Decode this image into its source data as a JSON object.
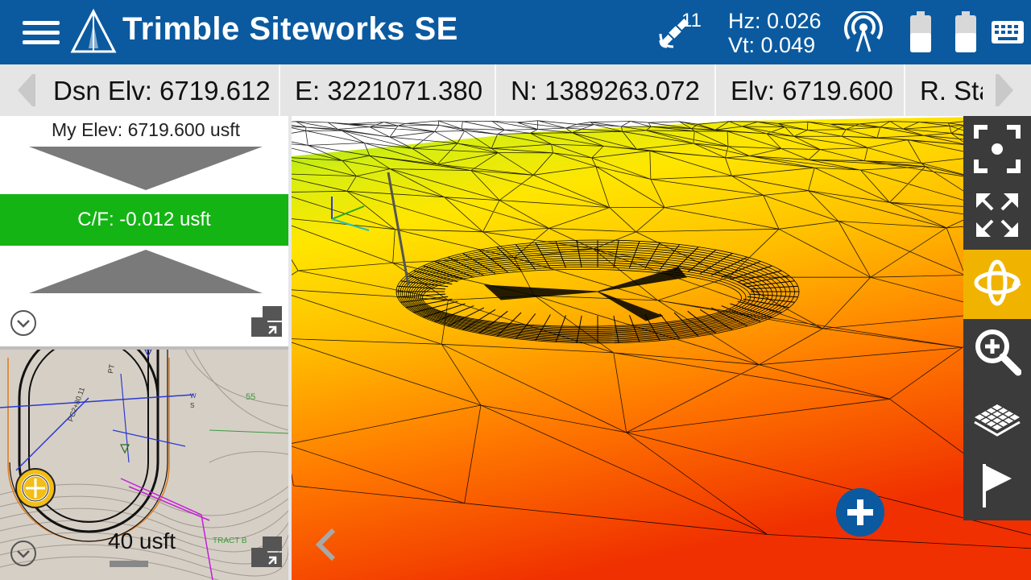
{
  "header": {
    "title": "Trimble Siteworks SE",
    "satellites": "11",
    "hz": "Hz: 0.026",
    "vt": "Vt: 0.049"
  },
  "info_strip": {
    "cells": [
      "Dsn Elv: 6719.612",
      "E: 3221071.380",
      "N: 1389263.072",
      "Elv: 6719.600",
      "R. Sta"
    ]
  },
  "left_panel": {
    "my_elev": "My Elev: 6719.600 usft",
    "cut_fill": "C/F: -0.012 usft",
    "map": {
      "scale": "40 usft",
      "labels": [
        "PC2+80.11",
        "PT",
        "55",
        "TRACT B",
        "W",
        "S"
      ]
    }
  },
  "toolbar": {
    "tools": [
      "zoom-window",
      "zoom-extents",
      "orbit",
      "zoom",
      "surface",
      "flag"
    ],
    "active": "orbit"
  },
  "colors": {
    "header": "#0b5aa0",
    "cut_fill": "#14b414",
    "toolbar": "#3b3b3b",
    "toolbar_active": "#f0b400"
  }
}
